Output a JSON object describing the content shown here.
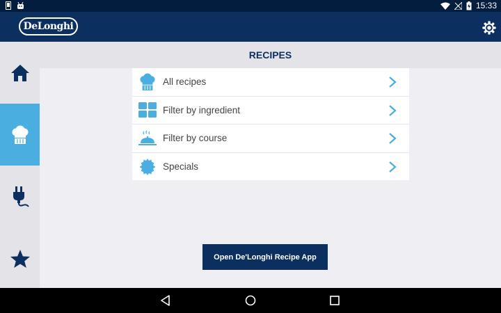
{
  "status_bar": {
    "time": "15:33",
    "left_icons": [
      "notification-icon",
      "android-icon"
    ],
    "right_icons": [
      "wifi-icon",
      "signal-off-icon",
      "battery-icon"
    ]
  },
  "app_bar": {
    "logo_text": "DeLonghi",
    "settings_icon": "gear-icon"
  },
  "sidebar": {
    "items": [
      {
        "icon": "home-icon",
        "active": false
      },
      {
        "icon": "chef-hat-icon",
        "active": true
      },
      {
        "icon": "plug-icon",
        "active": false
      },
      {
        "icon": "star-icon",
        "active": false
      }
    ]
  },
  "page": {
    "title": "RECIPES"
  },
  "menu": {
    "items": [
      {
        "label": "All recipes",
        "icon": "chef-hat-icon"
      },
      {
        "label": "Filter by ingredient",
        "icon": "grid-icon"
      },
      {
        "label": "Filter by course",
        "icon": "cloche-icon"
      },
      {
        "label": "Specials",
        "icon": "badge-icon"
      }
    ]
  },
  "open_app_button": {
    "label": "Open De'Longhi Recipe App"
  },
  "nav_bar": {
    "buttons": [
      "back-icon",
      "home-circle-icon",
      "recents-icon"
    ]
  },
  "colors": {
    "primary": "#0b2f5f",
    "accent": "#4aaee0",
    "background": "#efeef3"
  }
}
